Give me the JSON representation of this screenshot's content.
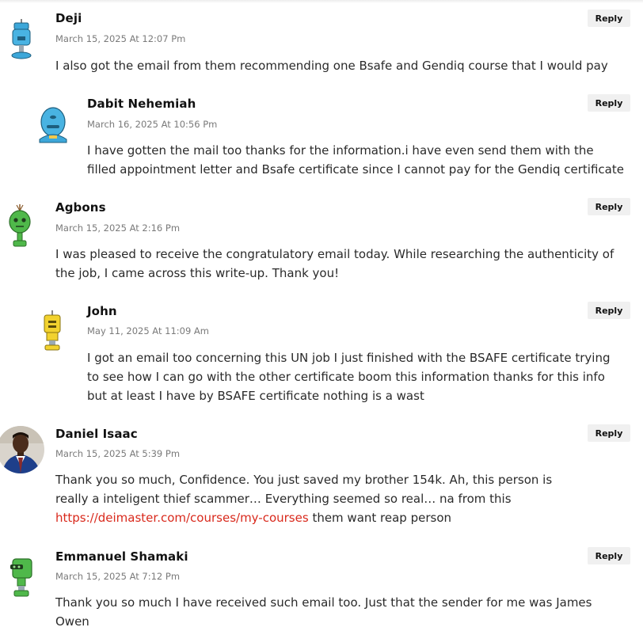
{
  "reply_label": "Reply",
  "link_color": "#d9291c",
  "comments": [
    {
      "author": "Deji",
      "date": "March 15, 2025 At 12:07 Pm",
      "text": "I also got the email from them recommending one Bsafe and Gendiq course that I would pay",
      "avatar": "blue-robot-avatar"
    },
    {
      "author": "Dabit Nehemiah",
      "date": "March 16, 2025 At 10:56 Pm",
      "text": "I have gotten the mail too thanks for the information.i have even send them with the filled appointment letter and Bsafe certificate since I cannot pay for the Gendiq certificate",
      "avatar": "blue-robot-avatar"
    },
    {
      "author": "Agbons",
      "date": "March 15, 2025 At 2:16 Pm",
      "text": "I was pleased to receive the congratulatory email today. While researching the authenticity of the job, I came across this write-up. Thank you!",
      "avatar": "green-robot-avatar"
    },
    {
      "author": "John",
      "date": "May 11, 2025 At 11:09 Am",
      "text": "I got an email too concerning this UN job I just finished with the BSAFE certificate trying to see how I can go with the other certificate boom this information thanks for this info but at least I have by BSAFE certificate nothing is a wast",
      "avatar": "yellow-robot-avatar"
    },
    {
      "author": "Daniel Isaac",
      "date": "March 15, 2025 At 5:39 Pm",
      "text_before": "Thank you so much, Confidence. You just saved my brother 154k. Ah, this person is really a inteligent thief scammer… Everything seemed so real… na from this ",
      "link": "https://deimaster.com/courses/my-courses",
      "text_after": " them want reap person",
      "avatar": "user-photo-avatar"
    },
    {
      "author": "Emmanuel Shamaki",
      "date": "March 15, 2025 At 7:12 Pm",
      "text": "Thank you so much I have received such email too. Just that the sender for me was James Owen",
      "avatar": "green-robot-avatar"
    }
  ]
}
